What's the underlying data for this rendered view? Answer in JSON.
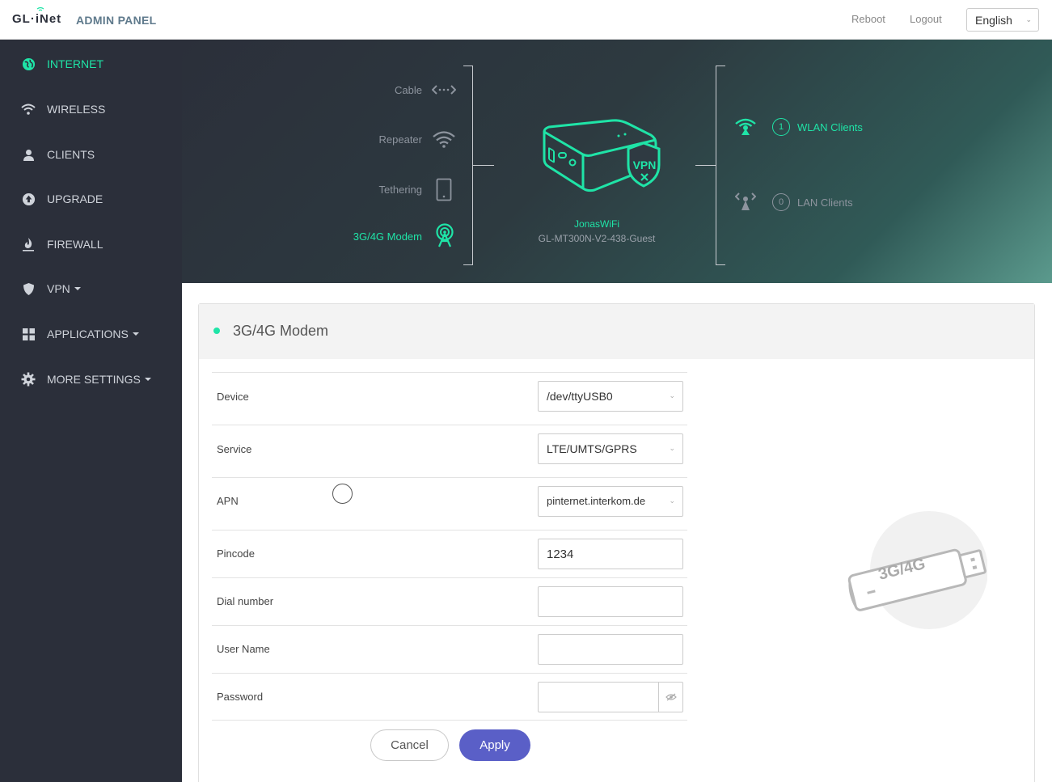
{
  "header": {
    "logo": "GL·iNet",
    "admin_label": "ADMIN PANEL",
    "reboot": "Reboot",
    "logout": "Logout",
    "language": "English"
  },
  "sidebar": {
    "items": [
      {
        "label": "INTERNET",
        "icon": "globe-icon",
        "active": true
      },
      {
        "label": "WIRELESS",
        "icon": "wifi-icon"
      },
      {
        "label": "CLIENTS",
        "icon": "user-icon"
      },
      {
        "label": "UPGRADE",
        "icon": "upload-icon"
      },
      {
        "label": "FIREWALL",
        "icon": "flame-icon"
      },
      {
        "label": "VPN",
        "icon": "shield-icon",
        "caret": true
      },
      {
        "label": "APPLICATIONS",
        "icon": "grid-icon",
        "caret": true
      },
      {
        "label": "MORE SETTINGS",
        "icon": "gear-icon",
        "caret": true
      }
    ]
  },
  "banner": {
    "sources": [
      {
        "label": "Cable"
      },
      {
        "label": "Repeater"
      },
      {
        "label": "Tethering"
      },
      {
        "label": "3G/4G Modem",
        "active": true
      }
    ],
    "device_name": "JonasWiFi",
    "device_ssid": "GL-MT300N-V2-438-Guest",
    "vpn_badge": "VPN",
    "wlan": {
      "count": "1",
      "label": "WLAN Clients"
    },
    "lan": {
      "count": "0",
      "label": "LAN Clients"
    }
  },
  "panel": {
    "title": "3G/4G Modem",
    "fields": {
      "device": {
        "label": "Device",
        "value": "/dev/ttyUSB0"
      },
      "service": {
        "label": "Service",
        "value": "LTE/UMTS/GPRS"
      },
      "apn": {
        "label": "APN",
        "value": "pinternet.interkom.de"
      },
      "pincode": {
        "label": "Pincode",
        "value": "1234"
      },
      "dial": {
        "label": "Dial number",
        "value": ""
      },
      "username": {
        "label": "User Name",
        "value": ""
      },
      "password": {
        "label": "Password",
        "value": ""
      }
    },
    "cancel": "Cancel",
    "apply": "Apply",
    "illustration_text": "3G/4G"
  },
  "colors": {
    "accent": "#1fe4a7",
    "sidebar": "#2b2f3a",
    "apply": "#5a5fc7"
  }
}
